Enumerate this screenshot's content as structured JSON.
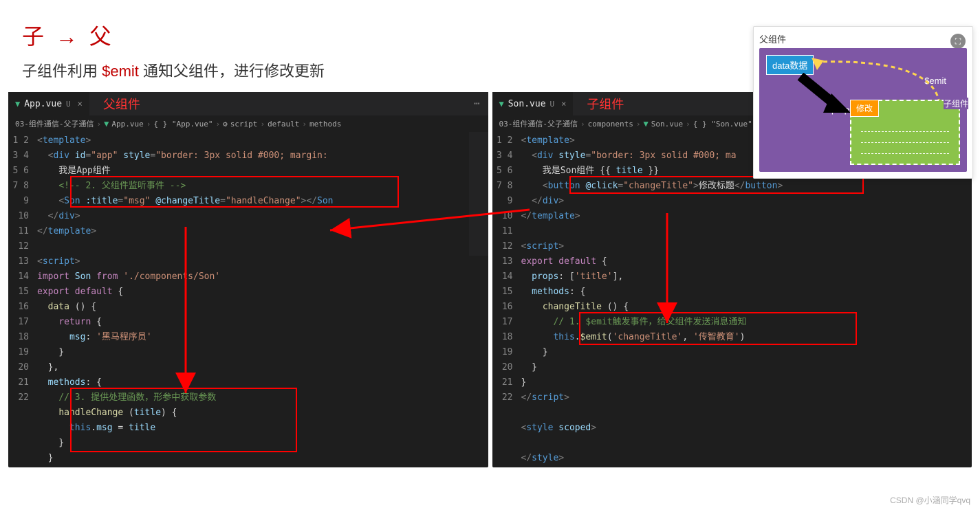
{
  "header": {
    "title_child": "子",
    "title_arrow": "→",
    "title_parent": "父",
    "subtitle_pre": "子组件利用 ",
    "subtitle_emit": "$emit",
    "subtitle_post": " 通知父组件，进行修改更新"
  },
  "left_editor": {
    "tab_file": "App.vue",
    "tab_status": "U",
    "label": "父组件",
    "breadcrumb": [
      "03-组件通信-父子通信",
      "App.vue",
      "{ } \"App.vue\"",
      "script",
      "default",
      "methods"
    ],
    "lines": {
      "1": "<template>",
      "2": "  <div id=\"app\" style=\"border: 3px solid #000; margin:",
      "3": "    我是App组件",
      "4": "    <!-- 2. 父组件监听事件 -->",
      "5": "    <Son :title=\"msg\" @changeTitle=\"handleChange\"></Son",
      "6": "  </div>",
      "7": "</template>",
      "8": "",
      "9": "<script>",
      "10": "import Son from './components/Son'",
      "11": "export default {",
      "12": "  data () {",
      "13": "    return {",
      "14": "      msg: '黑马程序员'",
      "15": "    }",
      "16": "  },",
      "17": "  methods: {",
      "18": "    // 3. 提供处理函数，形参中获取参数",
      "19": "    handleChange (title) {",
      "20": "      this.msg = title",
      "21": "    }",
      "22": "  }"
    }
  },
  "right_editor": {
    "tab_file": "Son.vue",
    "tab_status": "U",
    "label": "子组件",
    "breadcrumb": [
      "03-组件通信-父子通信",
      "components",
      "Son.vue",
      "{ } \"Son.vue\""
    ],
    "lines": {
      "1": "<template>",
      "2": "  <div style=\"border: 3px solid #000; ma",
      "3": "    我是Son组件 {{ title }}",
      "4": "    <button @click=\"changeTitle\">修改标题</button>",
      "5": "  </div>",
      "6": "</template>",
      "7": "",
      "8": "<script>",
      "9": "export default {",
      "10": "  props: ['title'],",
      "11": "  methods: {",
      "12": "    changeTitle () {",
      "13": "      // 1. $emit触发事件，给父组件发送消息通知",
      "14": "      this.$emit('changeTitle', '传智教育')",
      "15": "    }",
      "16": "  }",
      "17": "}",
      "18": "</script>",
      "19": "",
      "20": "<style scoped>",
      "21": "",
      "22": "</style>"
    }
  },
  "diagram": {
    "title": "父组件",
    "data_box": "data数据",
    "emit": "$emit",
    "props": "props",
    "modify": "修改",
    "child": "子组件"
  },
  "watermark": "CSDN @小涵同学qvq"
}
